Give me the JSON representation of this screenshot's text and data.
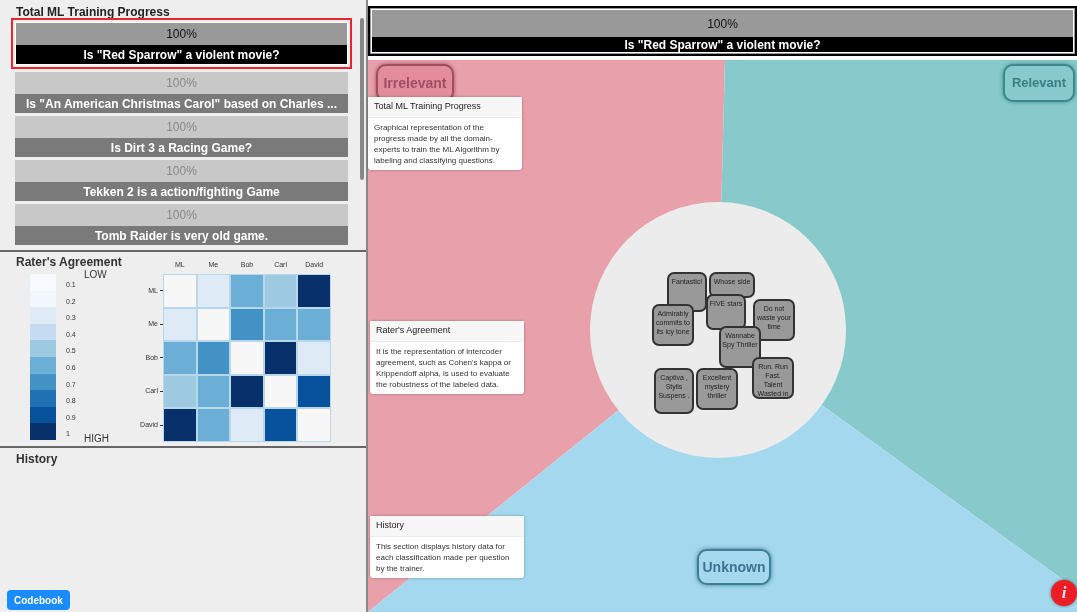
{
  "progress_panel": {
    "title": "Total ML Training Progress",
    "items": [
      {
        "percent": "100%",
        "question": "Is \"Red Sparrow\" a violent movie?",
        "selected": true
      },
      {
        "percent": "100%",
        "question": "Is \"An American Christmas Carol\" based on Charles ...",
        "selected": false
      },
      {
        "percent": "100%",
        "question": "Is Dirt 3 a Racing Game?",
        "selected": false
      },
      {
        "percent": "100%",
        "question": "Tekken 2 is a action/fighting Game",
        "selected": false
      },
      {
        "percent": "100%",
        "question": "Tomb Raider is very old game.",
        "selected": false
      }
    ]
  },
  "agreement_panel": {
    "title": "Rater's Agreement",
    "low_label": "LOW",
    "high_label": "HIGH",
    "legend": [
      {
        "label": "0.1",
        "color": "#f7fbff"
      },
      {
        "label": "0.2",
        "color": "#f1f7fd"
      },
      {
        "label": "0.3",
        "color": "#deebf7"
      },
      {
        "label": "0.4",
        "color": "#c6dbef"
      },
      {
        "label": "0.5",
        "color": "#9ecae1"
      },
      {
        "label": "0.6",
        "color": "#6baed6"
      },
      {
        "label": "0.7",
        "color": "#4292c6"
      },
      {
        "label": "0.8",
        "color": "#2171b5"
      },
      {
        "label": "0.9",
        "color": "#08519c"
      },
      {
        "label": "1",
        "color": "#08306b"
      }
    ],
    "columns": [
      "ML",
      "Me",
      "Bob",
      "Carl",
      "David"
    ],
    "rows": [
      {
        "label": "ML",
        "cells": [
          {
            "color": "#f7f7f7"
          },
          {
            "color": "#deebf7"
          },
          {
            "color": "#6baed6"
          },
          {
            "color": "#9ecae1"
          },
          {
            "color": "#08306b"
          }
        ]
      },
      {
        "label": "Me",
        "cells": [
          {
            "color": "#deebf7"
          },
          {
            "color": "#f7f7f7"
          },
          {
            "color": "#4292c6"
          },
          {
            "color": "#6baed6"
          },
          {
            "color": "#6baed6"
          }
        ]
      },
      {
        "label": "Bob",
        "cells": [
          {
            "color": "#6baed6"
          },
          {
            "color": "#4292c6"
          },
          {
            "color": "#f7f7f7"
          },
          {
            "color": "#08306b"
          },
          {
            "color": "#deebf7"
          }
        ]
      },
      {
        "label": "Carl",
        "cells": [
          {
            "color": "#9ecae1"
          },
          {
            "color": "#6baed6"
          },
          {
            "color": "#08306b"
          },
          {
            "color": "#f7f7f7"
          },
          {
            "color": "#08519c"
          }
        ]
      },
      {
        "label": "David",
        "cells": [
          {
            "color": "#08306b"
          },
          {
            "color": "#6baed6"
          },
          {
            "color": "#deebf7"
          },
          {
            "color": "#08519c"
          },
          {
            "color": "#f7f7f7"
          }
        ]
      }
    ]
  },
  "history_panel": {
    "title": "History"
  },
  "codebook_button": "Codebook",
  "current_question": {
    "percent": "100%",
    "question": "Is \"Red Sparrow\" a violent movie?"
  },
  "zones": {
    "irrelevant": "Irrelevant",
    "relevant": "Relevant",
    "unknown": "Unknown"
  },
  "answer_cards": [
    {
      "text": "Fantastic!"
    },
    {
      "text": "Whose side"
    },
    {
      "text": "Admirably commits to its icy tone"
    },
    {
      "text": "FIVE stars"
    },
    {
      "text": "Do not waste your time"
    },
    {
      "text": "Wannabe Spy Thriller"
    },
    {
      "text": "Captiva , Stylis Suspens ."
    },
    {
      "text": "Excellent mystery thriller"
    },
    {
      "text": "Run. Run Fast. Talent Wasted in"
    }
  ],
  "tooltips": [
    {
      "title": "Total ML Training Progress",
      "body": "Graphical representation of the progress made by all the domain-experts to train the ML Algorithm by labeling and classifying questions."
    },
    {
      "title": "Rater's Agreement",
      "body": "It is the representation of intercoder agreement, such as Cohen's kappa or Krippendoff alpha, is used to evaluate the robustness of the labeled data."
    },
    {
      "title": "History",
      "body": "This section displays history data for each classification made per question by the trainer."
    }
  ],
  "info_button": "i"
}
